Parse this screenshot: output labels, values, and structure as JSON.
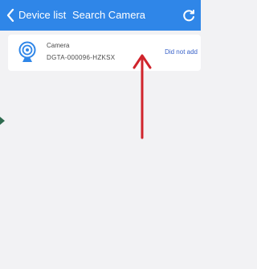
{
  "header": {
    "back_label": "Device list",
    "title": "Search Camera",
    "back_icon": "chevron-left-icon",
    "refresh_icon": "refresh-icon"
  },
  "devices": [
    {
      "icon": "webcam-icon",
      "name": "Camera",
      "id": "DGTA-000096-HZKSX",
      "status": "Did not add"
    }
  ],
  "colors": {
    "header": "#2f86e8",
    "background": "#f2f2f4",
    "status_text": "#3a63c9",
    "annotation_arrow": "#d0242c"
  }
}
